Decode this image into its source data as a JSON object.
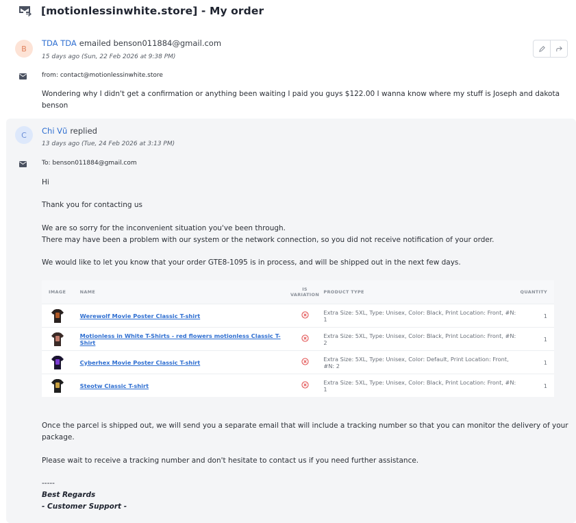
{
  "title": "[motionlessinwhite.store] - My order",
  "message1": {
    "avatar": "B",
    "author": "TDA TDA",
    "verb": "emailed benson011884@gmail.com",
    "date": "15 days ago (Sun, 22 Feb 2026 at 9:38 PM)",
    "from": "from: contact@motionlessinwhite.store",
    "body": "Wondering why I didn't get a confirmation or anything been waiting I paid you guys $122.00 I wanna know where my stuff is Joseph and dakota benson"
  },
  "message2": {
    "avatar": "C",
    "author": "Chi Vũ",
    "verb": "replied",
    "date": "13 days ago (Tue, 24 Feb 2026 at 3:13 PM)",
    "to": "To: benson011884@gmail.com",
    "p1": "Hi",
    "p2": "Thank you for contacting us",
    "p3a": "We are so sorry for the inconvenient situation you've been through.",
    "p3b": "There may have been a problem with our system or the network connection, so you did not receive notification of your order.",
    "p4": "We would like to let you know that your order GTE8-1095 is in process, and will be shipped out in the next few days.",
    "p5a": "Once the parcel is shipped out, we will send you a separate email that will include a tracking number so that you can monitor the delivery of your",
    "p5b": "package.",
    "p6": "Please wait to receive a tracking number and don't hesitate to contact us if you need further assistance.",
    "sig_dash": "-----",
    "sig_regards": "Best Regards",
    "sig_team": "- Customer Support -"
  },
  "table": {
    "headers": {
      "image": "IMAGE",
      "name": "NAME",
      "var1": "IS",
      "var2": "VARIATION",
      "type": "PRODUCT TYPE",
      "qty": "QUANTITY"
    },
    "rows": [
      {
        "name": "Werewolf Movie Poster Classic T-shirt",
        "type": "Extra Size: 5XL, Type: Unisex, Color: Black, Print Location: Front, #N: 1",
        "qty": "1",
        "shirt_color": "#2a2220",
        "print_color": "#b05a28"
      },
      {
        "name": "Motionless in White T-Shirts - red flowers motionless Classic T-Shirt",
        "type": "Extra Size: 5XL, Type: Unisex, Color: Black, Print Location: Front, #N: 2",
        "qty": "1",
        "shirt_color": "#3a2a26",
        "print_color": "#c07a6a"
      },
      {
        "name": "Cyberhex Movie Poster Classic T-shirt",
        "type": "Extra Size: 5XL, Type: Unisex, Color: Default, Print Location: Front, #N: 2",
        "qty": "1",
        "shirt_color": "#1a1430",
        "print_color": "#7a3ad0"
      },
      {
        "name": "Steotw Classic T-shirt",
        "type": "Extra Size: 5XL, Type: Unisex, Color: Black, Print Location: Front, #N: 1",
        "qty": "1",
        "shirt_color": "#1f1f1f",
        "print_color": "#c8a040"
      }
    ]
  },
  "colors": {
    "link": "#2f6fd1",
    "error": "#e04848",
    "panel": "#f4f5f7"
  }
}
